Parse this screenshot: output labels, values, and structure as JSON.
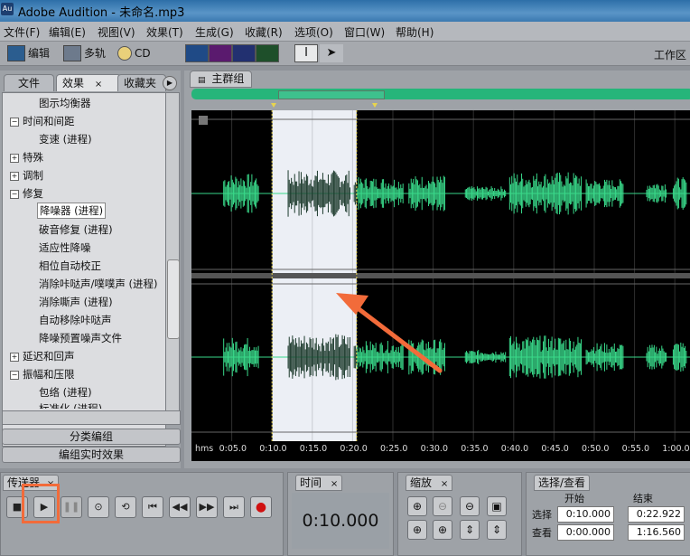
{
  "window": {
    "app_icon": "Au",
    "title": "Adobe Audition - 未命名.mp3"
  },
  "menu": [
    "文件(F)",
    "编辑(E)",
    "视图(V)",
    "效果(T)",
    "生成(G)",
    "收藏(R)",
    "选项(O)",
    "窗口(W)",
    "帮助(H)"
  ],
  "toolbar": {
    "edit_label": "编辑",
    "multitrack_label": "多轨",
    "cd_label": "CD",
    "workspace_label": "工作区"
  },
  "left_panel": {
    "tabs": [
      "文件",
      "效果",
      "收藏夹"
    ],
    "tab_close": "×",
    "tree": [
      {
        "label": "图示均衡器",
        "level": 1
      },
      {
        "label": "时间和间距",
        "level": 0,
        "expanded": true
      },
      {
        "label": "变速 (进程)",
        "level": 1
      },
      {
        "label": "特殊",
        "level": 0,
        "expanded": false
      },
      {
        "label": "调制",
        "level": 0,
        "expanded": false
      },
      {
        "label": "修复",
        "level": 0,
        "expanded": true
      },
      {
        "label": "降噪器 (进程)",
        "level": 1,
        "selected": true
      },
      {
        "label": "破音修复 (进程)",
        "level": 1
      },
      {
        "label": "适应性降噪",
        "level": 1
      },
      {
        "label": "相位自动校正",
        "level": 1
      },
      {
        "label": "消除咔哒声/噗噗声 (进程)",
        "level": 1
      },
      {
        "label": "消除嘶声 (进程)",
        "level": 1
      },
      {
        "label": "自动移除咔哒声",
        "level": 1
      },
      {
        "label": "降噪预置噪声文件",
        "level": 1
      },
      {
        "label": "延迟和回声",
        "level": 0,
        "expanded": false
      },
      {
        "label": "振幅和压限",
        "level": 0,
        "expanded": true
      },
      {
        "label": "包络 (进程)",
        "level": 1
      },
      {
        "label": "标准化 (进程)",
        "level": 1
      }
    ],
    "buttons": [
      "分类编组",
      "编组实时效果"
    ]
  },
  "main": {
    "tab": "主群组",
    "ruler_unit": "hms",
    "ticks": [
      "0:05.0",
      "0:10.0",
      "0:15.0",
      "0:20.0",
      "0:25.0",
      "0:30.0",
      "0:35.0",
      "0:40.0",
      "0:45.0",
      "0:50.0",
      "0:55.0",
      "1:00.0"
    ],
    "selection_start_s": 10.0,
    "selection_end_s": 20.5
  },
  "transport": {
    "title": "传送器",
    "buttons": [
      "stop-icon",
      "play-icon",
      "pause-icon",
      "play-to-end-icon",
      "loop-icon",
      "go-start-icon",
      "rewind-icon",
      "fast-forward-icon",
      "go-end-icon",
      "record-icon"
    ]
  },
  "time": {
    "title": "时间",
    "value": "0:10.000"
  },
  "zoom": {
    "title": "缩放"
  },
  "selection": {
    "title": "选择/查看",
    "col_start": "开始",
    "col_end": "结束",
    "row_select": "选择",
    "row_view": "查看",
    "sel_start": "0:10.000",
    "sel_end": "0:22.922",
    "view_start": "0:00.000",
    "view_end": "1:16.560"
  },
  "colors": {
    "waveform": "#39d98a",
    "selection_bg": "#eceff5",
    "highlight": "#f26b3a"
  }
}
